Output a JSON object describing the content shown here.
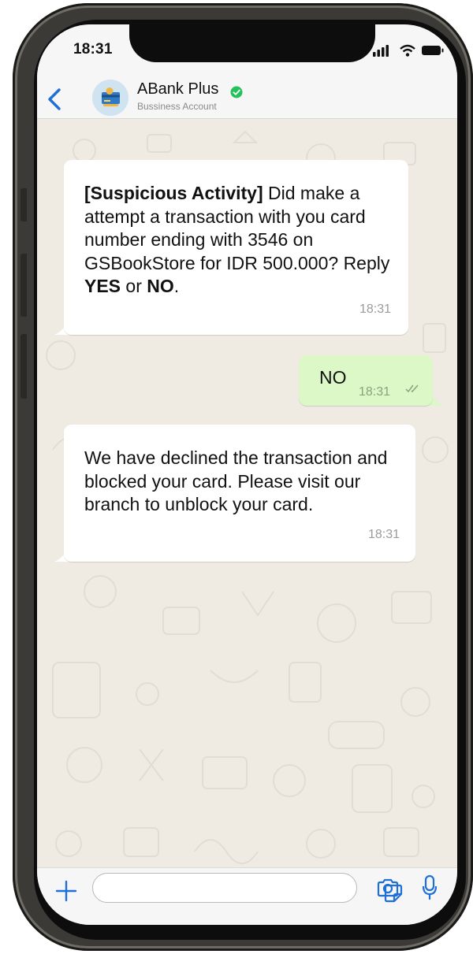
{
  "status_bar": {
    "time": "18:31"
  },
  "header": {
    "back_icon": "chevron-left-icon",
    "contact_name": "ABank Plus",
    "contact_subtitle": "Bussiness Account",
    "verified_icon": "verified-check-icon",
    "accent_color": "#1e6fd6",
    "verified_color": "#25c15a"
  },
  "messages": [
    {
      "direction": "incoming",
      "bold_prefix": "[Suspicious Activity]",
      "text": " Did make a attempt a transaction with you card number ending with 3546 on GSBookStore for IDR 500.000? Reply ",
      "bold_yes": "YES",
      "or_text": " or ",
      "bold_no": "NO",
      "end": ".",
      "time": "18:31"
    },
    {
      "direction": "outgoing",
      "text": "NO",
      "time": "18:31",
      "status_icon": "double-check-icon"
    },
    {
      "direction": "incoming",
      "text": "We have declined the transaction and blocked your card. Please visit our branch to unblock your card.",
      "time": "18:31"
    }
  ],
  "input_bar": {
    "plus_icon": "plus-icon",
    "message_placeholder": "",
    "sticker_icon": "sticker-icon",
    "camera_icon": "camera-icon",
    "mic_icon": "microphone-icon"
  },
  "colors": {
    "chat_background": "#efeae2",
    "incoming_bubble": "#ffffff",
    "outgoing_bubble": "#dbf8c6"
  }
}
